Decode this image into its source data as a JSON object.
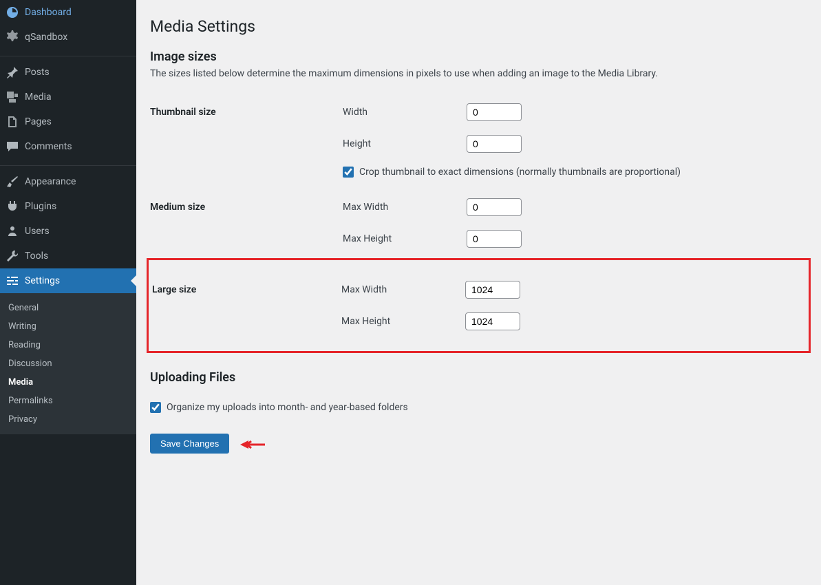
{
  "sidebar": {
    "items": [
      {
        "label": "Dashboard"
      },
      {
        "label": "qSandbox"
      },
      {
        "label": "Posts"
      },
      {
        "label": "Media"
      },
      {
        "label": "Pages"
      },
      {
        "label": "Comments"
      },
      {
        "label": "Appearance"
      },
      {
        "label": "Plugins"
      },
      {
        "label": "Users"
      },
      {
        "label": "Tools"
      },
      {
        "label": "Settings"
      }
    ],
    "submenu": [
      {
        "label": "General"
      },
      {
        "label": "Writing"
      },
      {
        "label": "Reading"
      },
      {
        "label": "Discussion"
      },
      {
        "label": "Media"
      },
      {
        "label": "Permalinks"
      },
      {
        "label": "Privacy"
      }
    ]
  },
  "page": {
    "title": "Media Settings",
    "section_image_sizes": "Image sizes",
    "description": "The sizes listed below determine the maximum dimensions in pixels to use when adding an image to the Media Library.",
    "section_uploading": "Uploading Files"
  },
  "thumbnail": {
    "heading": "Thumbnail size",
    "width_label": "Width",
    "width_value": "0",
    "height_label": "Height",
    "height_value": "0",
    "crop_label": "Crop thumbnail to exact dimensions (normally thumbnails are proportional)",
    "crop_checked": true
  },
  "medium": {
    "heading": "Medium size",
    "max_width_label": "Max Width",
    "max_width_value": "0",
    "max_height_label": "Max Height",
    "max_height_value": "0"
  },
  "large": {
    "heading": "Large size",
    "max_width_label": "Max Width",
    "max_width_value": "1024",
    "max_height_label": "Max Height",
    "max_height_value": "1024"
  },
  "uploading": {
    "organize_label": "Organize my uploads into month- and year-based folders",
    "organize_checked": true
  },
  "actions": {
    "save_label": "Save Changes"
  }
}
